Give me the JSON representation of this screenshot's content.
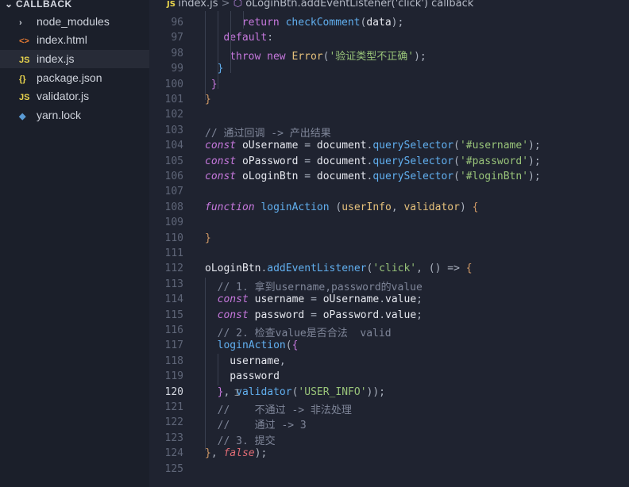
{
  "sidebar": {
    "folder": "CALLBACK",
    "items": [
      {
        "icon": "›",
        "icon_name": "chevron-right-icon",
        "label": "node_modules",
        "color": "#cfd3dc"
      },
      {
        "icon": "<>",
        "icon_name": "html-file-icon",
        "label": "index.html",
        "color": "#e37933"
      },
      {
        "icon": "JS",
        "icon_name": "js-file-icon",
        "label": "index.js",
        "color": "#e8d44d",
        "active": true
      },
      {
        "icon": "{}",
        "icon_name": "json-file-icon",
        "label": "package.json",
        "color": "#e8d44d"
      },
      {
        "icon": "JS",
        "icon_name": "js-file-icon",
        "label": "validator.js",
        "color": "#e8d44d"
      },
      {
        "icon": "◆",
        "icon_name": "yarn-file-icon",
        "label": "yarn.lock",
        "color": "#5a9bd5"
      }
    ]
  },
  "breadcrumb": {
    "file": "index.js",
    "separator": ">",
    "symbol_icon": "⬡",
    "symbol": "oLoginBtn.addEventListener('click') callback"
  },
  "editor": {
    "current_line": "120",
    "lines": [
      {
        "n": "96",
        "tokens": [
          [
            "t-kw2",
            "return "
          ],
          [
            "t-fn",
            "checkComment"
          ],
          [
            "t-pun",
            "("
          ],
          [
            "t-var",
            "data"
          ],
          [
            "t-pun",
            ");"
          ]
        ]
      },
      {
        "n": "97",
        "tokens": [
          [
            "t-kw2",
            "default"
          ],
          [
            "t-pun",
            ":"
          ]
        ]
      },
      {
        "n": "98",
        "tokens": [
          [
            "t-kw2",
            "throw "
          ],
          [
            "t-kw2",
            "new "
          ],
          [
            "t-prm",
            "Error"
          ],
          [
            "t-pun",
            "("
          ],
          [
            "t-str",
            "'验证类型不正确'"
          ],
          [
            "t-pun",
            ");"
          ]
        ]
      },
      {
        "n": "99",
        "tokens": [
          [
            "t-brk3",
            "}"
          ]
        ]
      },
      {
        "n": "100",
        "tokens": [
          [
            "t-brk2",
            "}"
          ]
        ]
      },
      {
        "n": "101",
        "tokens": [
          [
            "t-brk",
            "}"
          ]
        ]
      },
      {
        "n": "102",
        "tokens": []
      },
      {
        "n": "103",
        "tokens": [
          [
            "t-com",
            "// 通过回调 -> 产出结果"
          ]
        ]
      },
      {
        "n": "104",
        "tokens": [
          [
            "t-kw",
            "const "
          ],
          [
            "t-var",
            "oUsername "
          ],
          [
            "t-pun",
            "= "
          ],
          [
            "t-var",
            "document"
          ],
          [
            "t-pun",
            "."
          ],
          [
            "t-fn",
            "querySelector"
          ],
          [
            "t-pun",
            "("
          ],
          [
            "t-str",
            "'#username'"
          ],
          [
            "t-pun",
            ");"
          ]
        ]
      },
      {
        "n": "105",
        "tokens": [
          [
            "t-kw",
            "const "
          ],
          [
            "t-var",
            "oPassword "
          ],
          [
            "t-pun",
            "= "
          ],
          [
            "t-var",
            "document"
          ],
          [
            "t-pun",
            "."
          ],
          [
            "t-fn",
            "querySelector"
          ],
          [
            "t-pun",
            "("
          ],
          [
            "t-str",
            "'#password'"
          ],
          [
            "t-pun",
            ");"
          ]
        ]
      },
      {
        "n": "106",
        "tokens": [
          [
            "t-kw",
            "const "
          ],
          [
            "t-var",
            "oLoginBtn "
          ],
          [
            "t-pun",
            "= "
          ],
          [
            "t-var",
            "document"
          ],
          [
            "t-pun",
            "."
          ],
          [
            "t-fn",
            "querySelector"
          ],
          [
            "t-pun",
            "("
          ],
          [
            "t-str",
            "'#loginBtn'"
          ],
          [
            "t-pun",
            ");"
          ]
        ]
      },
      {
        "n": "107",
        "tokens": []
      },
      {
        "n": "108",
        "tokens": [
          [
            "t-kw",
            "function "
          ],
          [
            "t-fn",
            "loginAction "
          ],
          [
            "t-pun",
            "("
          ],
          [
            "t-prm",
            "userInfo"
          ],
          [
            "t-pun",
            ", "
          ],
          [
            "t-prm",
            "validator"
          ],
          [
            "t-pun",
            ") "
          ],
          [
            "t-brk",
            "{"
          ]
        ]
      },
      {
        "n": "109",
        "tokens": []
      },
      {
        "n": "110",
        "tokens": [
          [
            "t-brk",
            "}"
          ]
        ]
      },
      {
        "n": "111",
        "tokens": []
      },
      {
        "n": "112",
        "tokens": [
          [
            "t-var",
            "oLoginBtn"
          ],
          [
            "t-pun",
            "."
          ],
          [
            "t-fn",
            "addEventListener"
          ],
          [
            "t-pun",
            "("
          ],
          [
            "t-str",
            "'click'"
          ],
          [
            "t-pun",
            ", "
          ],
          [
            "t-pun",
            "() => "
          ],
          [
            "t-brk",
            "{"
          ]
        ]
      },
      {
        "n": "113",
        "tokens": [
          [
            "t-com",
            "  // 1. 拿到username,password的value"
          ]
        ]
      },
      {
        "n": "114",
        "tokens": [
          [
            "t-kw",
            "  const "
          ],
          [
            "t-var",
            "username "
          ],
          [
            "t-pun",
            "= "
          ],
          [
            "t-var",
            "oUsername"
          ],
          [
            "t-pun",
            "."
          ],
          [
            "t-var",
            "value"
          ],
          [
            "t-pun",
            ";"
          ]
        ]
      },
      {
        "n": "115",
        "tokens": [
          [
            "t-kw",
            "  const "
          ],
          [
            "t-var",
            "password "
          ],
          [
            "t-pun",
            "= "
          ],
          [
            "t-var",
            "oPassword"
          ],
          [
            "t-pun",
            "."
          ],
          [
            "t-var",
            "value"
          ],
          [
            "t-pun",
            ";"
          ]
        ]
      },
      {
        "n": "116",
        "tokens": [
          [
            "t-com",
            "  // 2. 检查value是否合法  valid"
          ]
        ]
      },
      {
        "n": "117",
        "tokens": [
          [
            "t-fn",
            "  loginAction"
          ],
          [
            "t-pun",
            "("
          ],
          [
            "t-brk2",
            "{"
          ]
        ]
      },
      {
        "n": "118",
        "tokens": [
          [
            "t-var",
            "    username"
          ],
          [
            "t-pun",
            ","
          ]
        ]
      },
      {
        "n": "119",
        "tokens": [
          [
            "t-var",
            "    password"
          ]
        ]
      },
      {
        "n": "120",
        "tokens": [
          [
            "t-brk2",
            "  }"
          ],
          [
            "t-pun",
            ", "
          ],
          [
            "t-fn",
            "validator"
          ],
          [
            "t-pun",
            "("
          ],
          [
            "t-str",
            "'USER_INFO'"
          ],
          [
            "t-pun",
            "));"
          ]
        ]
      },
      {
        "n": "121",
        "tokens": [
          [
            "t-com",
            "  //    不通过 -> 非法处理"
          ]
        ]
      },
      {
        "n": "122",
        "tokens": [
          [
            "t-com",
            "  //    通过 -> 3"
          ]
        ]
      },
      {
        "n": "123",
        "tokens": [
          [
            "t-com",
            "  // 3. 提交"
          ]
        ]
      },
      {
        "n": "124",
        "tokens": [
          [
            "t-brk",
            "}"
          ],
          [
            "t-pun",
            ", "
          ],
          [
            "t-bool",
            "false"
          ],
          [
            "t-pun",
            ");"
          ]
        ]
      },
      {
        "n": "125",
        "tokens": []
      }
    ]
  }
}
